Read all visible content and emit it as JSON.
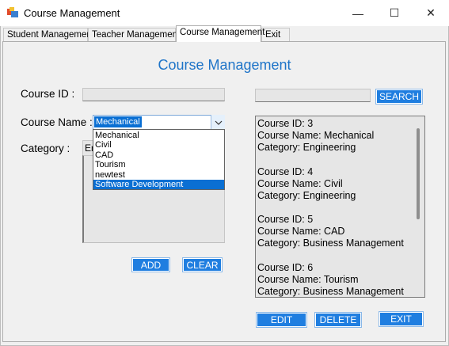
{
  "window": {
    "title": "Course Management",
    "controls": {
      "minimize": "—",
      "maximize": "☐",
      "close": "✕"
    }
  },
  "tabs": [
    {
      "label": "Student Management"
    },
    {
      "label": "Teacher Management"
    },
    {
      "label": "Course Management",
      "active": true
    },
    {
      "label": "Exit"
    }
  ],
  "form": {
    "heading": "Course Management",
    "course_id_label": "Course ID :",
    "course_id_value": "",
    "course_name_label": "Course Name :",
    "course_name_value": "Mechanical",
    "category_label": "Category :",
    "category_value": "En",
    "options": [
      "Mechanical",
      "Civil",
      "CAD",
      "Tourism",
      "newtest",
      "Software Development"
    ],
    "highlighted_option": "Software Development",
    "add_label": "ADD",
    "clear_label": "CLEAR"
  },
  "search": {
    "value": "",
    "button_label": "SEARCH"
  },
  "results": {
    "lines": [
      "Course ID: 3",
      "Course Name: Mechanical",
      "Category: Engineering",
      "",
      "Course ID: 4",
      "Course Name: Civil",
      "Category: Engineering",
      "",
      "Course ID: 5",
      "Course Name: CAD",
      "Category: Business Management",
      "",
      "Course ID: 6",
      "Course Name: Tourism",
      "Category: Business Management"
    ]
  },
  "actions": {
    "edit_label": "EDIT",
    "delete_label": "DELETE",
    "exit_label": "EXIT"
  },
  "colors": {
    "accent": "#1e74c8",
    "button": "#1f7ee0",
    "selection": "#0a6fd3"
  },
  "icons": {
    "app": "app-icon",
    "dropdown": "chevron-down-icon"
  }
}
